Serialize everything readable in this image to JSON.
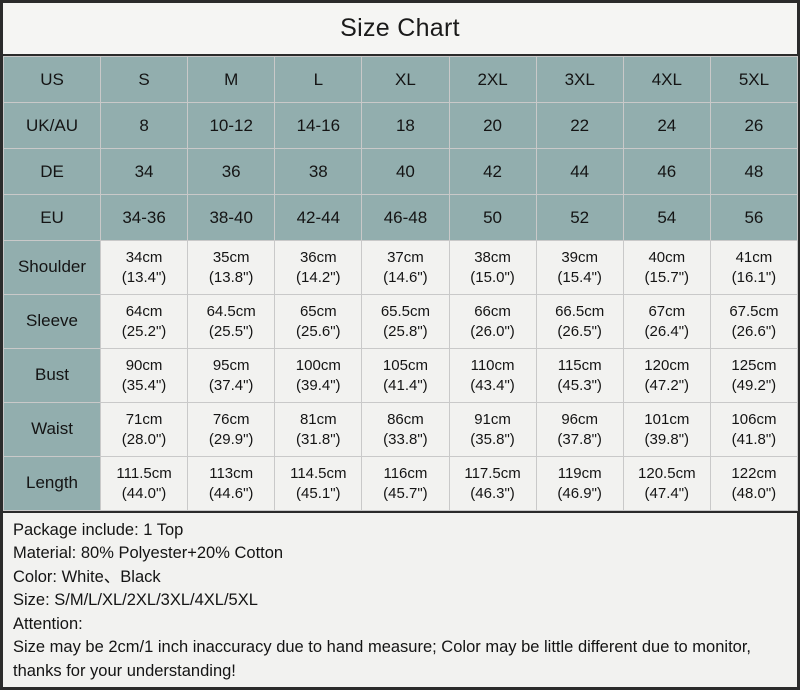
{
  "title": "Size Chart",
  "colors": {
    "header_teal": "#92aeae",
    "cell_background": "#f2f2f0",
    "title_background": "#f5f5f3",
    "outer_border": "#2b2b2b",
    "grid_line": "#c9c9c9",
    "text": "#141414"
  },
  "table": {
    "size_columns": [
      "S",
      "M",
      "L",
      "XL",
      "2XL",
      "3XL",
      "4XL",
      "5XL"
    ],
    "conversion_rows": [
      {
        "label": "US",
        "values": [
          "S",
          "M",
          "L",
          "XL",
          "2XL",
          "3XL",
          "4XL",
          "5XL"
        ]
      },
      {
        "label": "UK/AU",
        "values": [
          "8",
          "10-12",
          "14-16",
          "18",
          "20",
          "22",
          "24",
          "26"
        ]
      },
      {
        "label": "DE",
        "values": [
          "34",
          "36",
          "38",
          "40",
          "42",
          "44",
          "46",
          "48"
        ]
      },
      {
        "label": "EU",
        "values": [
          "34-36",
          "38-40",
          "42-44",
          "46-48",
          "50",
          "52",
          "54",
          "56"
        ]
      }
    ],
    "measurement_rows": [
      {
        "label": "Shoulder",
        "cm": [
          "34cm",
          "35cm",
          "36cm",
          "37cm",
          "38cm",
          "39cm",
          "40cm",
          "41cm"
        ],
        "inch": [
          "(13.4\")",
          "(13.8\")",
          "(14.2\")",
          "(14.6\")",
          "(15.0\")",
          "(15.4\")",
          "(15.7\")",
          "(16.1\")"
        ]
      },
      {
        "label": "Sleeve",
        "cm": [
          "64cm",
          "64.5cm",
          "65cm",
          "65.5cm",
          "66cm",
          "66.5cm",
          "67cm",
          "67.5cm"
        ],
        "inch": [
          "(25.2\")",
          "(25.5\")",
          "(25.6\")",
          "(25.8\")",
          "(26.0\")",
          "(26.5\")",
          "(26.4\")",
          "(26.6\")"
        ]
      },
      {
        "label": "Bust",
        "cm": [
          "90cm",
          "95cm",
          "100cm",
          "105cm",
          "110cm",
          "115cm",
          "120cm",
          "125cm"
        ],
        "inch": [
          "(35.4\")",
          "(37.4\")",
          "(39.4\")",
          "(41.4\")",
          "(43.4\")",
          "(45.3\")",
          "(47.2\")",
          "(49.2\")"
        ]
      },
      {
        "label": "Waist",
        "cm": [
          "71cm",
          "76cm",
          "81cm",
          "86cm",
          "91cm",
          "96cm",
          "101cm",
          "106cm"
        ],
        "inch": [
          "(28.0\")",
          "(29.9\")",
          "(31.8\")",
          "(33.8\")",
          "(35.8\")",
          "(37.8\")",
          "(39.8\")",
          "(41.8\")"
        ]
      },
      {
        "label": "Length",
        "cm": [
          "111.5cm",
          "113cm",
          "114.5cm",
          "116cm",
          "117.5cm",
          "119cm",
          "120.5cm",
          "122cm"
        ],
        "inch": [
          "(44.0\")",
          "(44.6\")",
          "(45.1\")",
          "(45.7\")",
          "(46.3\")",
          "(46.9\")",
          "(47.4\")",
          "(48.0\")"
        ]
      }
    ]
  },
  "notes": {
    "package": "Package include: 1 Top",
    "material": "Material: 80% Polyester+20% Cotton",
    "color": "Color: White、Black",
    "size": "Size: S/M/L/XL/2XL/3XL/4XL/5XL",
    "attention_heading": "Attention:",
    "attention_body": "Size may be 2cm/1 inch inaccuracy due to hand measure; Color may be little different due to monitor, thanks for your understanding!"
  }
}
